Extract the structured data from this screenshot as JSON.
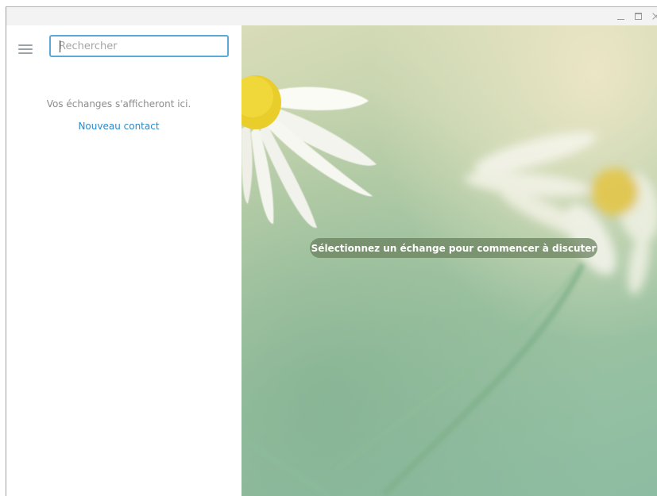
{
  "window": {
    "controls": [
      "minimize",
      "maximize",
      "close"
    ]
  },
  "sidebar": {
    "menu_icon": "hamburger-menu-icon",
    "search": {
      "placeholder": "Rechercher",
      "value": ""
    },
    "empty_message": "Vos échanges s'afficheront ici.",
    "new_contact_label": "Nouveau contact"
  },
  "chat": {
    "placeholder_message": "Sélectionnez un échange pour commencer à discuter",
    "background": "daisy-flowers-wallpaper"
  },
  "colors": {
    "accent": "#2a8ac9",
    "search_border": "#5aa9d6",
    "pill_bg": "#68805c"
  }
}
